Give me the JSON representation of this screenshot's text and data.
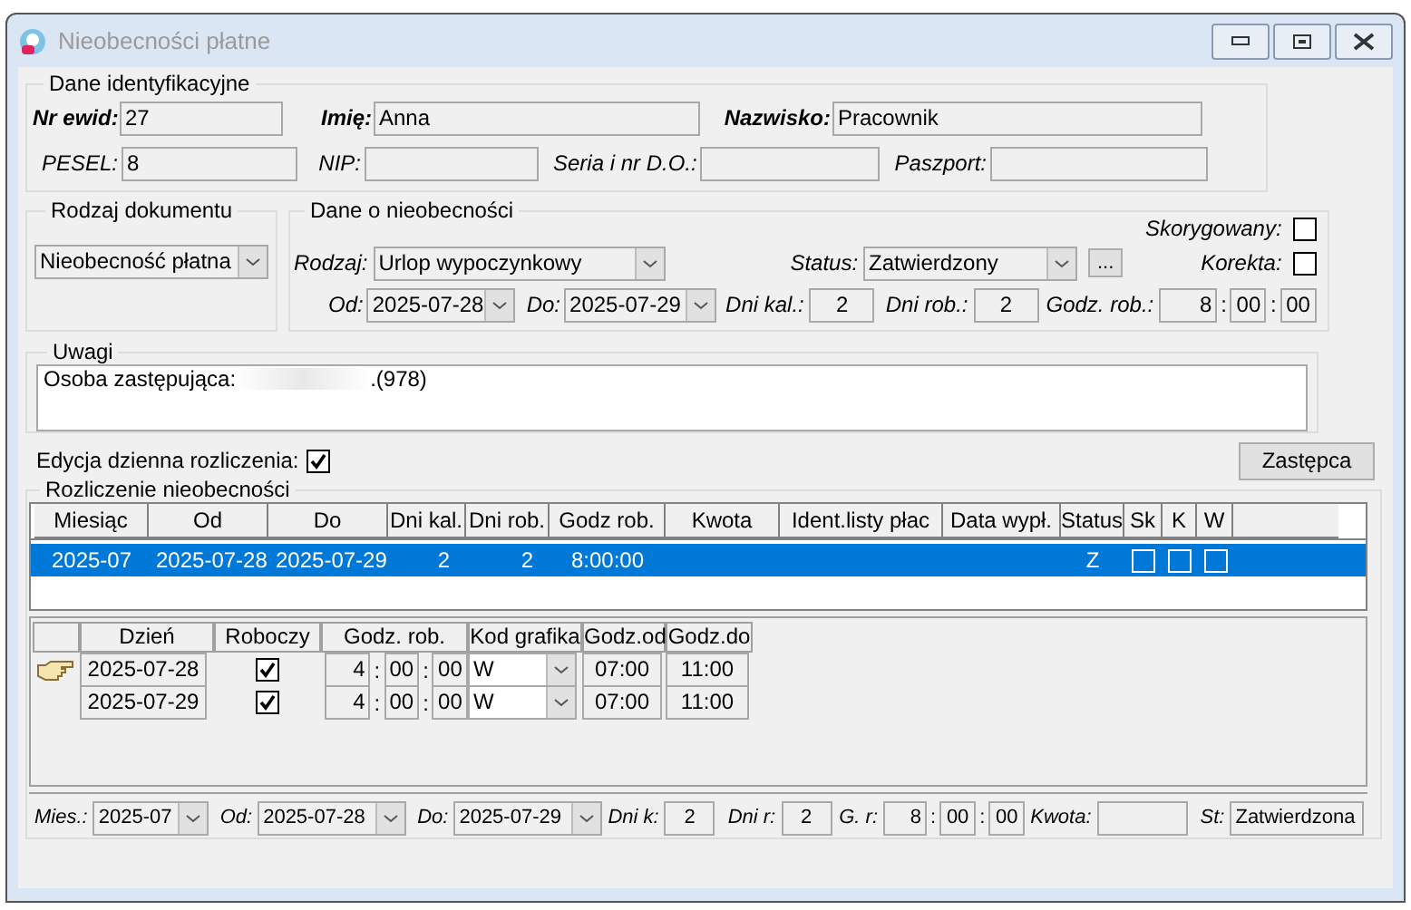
{
  "window": {
    "title": "Nieobecności płatne"
  },
  "identification": {
    "title": "Dane identyfikacyjne",
    "rows": [
      [
        {
          "label": "Nr ewid:",
          "required": true,
          "value": "27"
        },
        {
          "label": "Imię:",
          "required": true,
          "value": "Anna"
        },
        {
          "label": "Nazwisko:",
          "required": true,
          "value": "Pracownik"
        }
      ],
      [
        {
          "label": "PESEL:",
          "required": false,
          "value": "8"
        },
        {
          "label": "NIP:",
          "required": false
        },
        {
          "label": "Seria i nr D.O.:",
          "required": false
        },
        {
          "label": "Paszport:",
          "required": false
        }
      ]
    ]
  },
  "document_type": {
    "title": "Rodzaj dokumentu",
    "value": "Nieobecność płatna"
  },
  "absence": {
    "title": "Dane o nieobecności",
    "corrected": {
      "label": "Skorygowany:",
      "checked": false
    },
    "type": {
      "label": "Rodzaj:",
      "value": "Urlop wypoczynkowy"
    },
    "status": {
      "label": "Status:",
      "value": "Zatwierdzony",
      "more": "..."
    },
    "correction": {
      "label": "Korekta:",
      "checked": false
    },
    "from": {
      "label": "Od:",
      "value": "2025-07-28"
    },
    "to": {
      "label": "Do:",
      "value": "2025-07-29"
    },
    "cal_days": {
      "label": "Dni kal.:",
      "value": "2"
    },
    "work_days": {
      "label": "Dni rob.:",
      "value": "2"
    },
    "hours": {
      "label": "Godz. rob.:",
      "h": "8",
      "sep1": ":",
      "m": "00",
      "sep2": ":",
      "s": "00"
    }
  },
  "notes": {
    "title": "Uwagi",
    "value_start": "Osoba zastępująca:",
    "value_end": ".(978)"
  },
  "daily_edit": {
    "label": "Edycja dzienna rozliczenia:",
    "checked": true
  },
  "substitute_button": "Zastępca",
  "settlement": {
    "title": "Rozliczenie nieobecności",
    "columns": [
      "Miesiąc",
      "Od",
      "Do",
      "Dni kal.",
      "Dni rob.",
      "Godz rob.",
      "Kwota",
      "Ident.listy płac",
      "Data wypł.",
      "Status",
      "Sk",
      "K",
      "W"
    ],
    "rows": [
      {
        "selected": true,
        "month": "2025-07",
        "from": "2025-07-28",
        "to": "2025-07-29",
        "cal_days": "2",
        "work_days": "2",
        "hours": "8:00:00",
        "status": "Z",
        "sk": false,
        "k": false,
        "w": false
      }
    ]
  },
  "days": {
    "columns": [
      "Dzień",
      "Roboczy",
      "Godz. rob.",
      "Kod grafika",
      "Godz.od",
      "Godz.do"
    ],
    "rows": [
      {
        "current": true,
        "day": "2025-07-28",
        "working": true,
        "h": "4",
        "sep1": ":",
        "m": "00",
        "sep2": ":",
        "s": "00",
        "code": "W",
        "from": "07:00",
        "to": "11:00"
      },
      {
        "current": false,
        "day": "2025-07-29",
        "working": true,
        "h": "4",
        "sep1": ":",
        "m": "00",
        "sep2": ":",
        "s": "00",
        "code": "W",
        "from": "07:00",
        "to": "11:00"
      }
    ]
  },
  "footer": {
    "month": {
      "label": "Mies.:",
      "value": "2025-07"
    },
    "from": {
      "label": "Od:",
      "value": "2025-07-28"
    },
    "to": {
      "label": "Do:",
      "value": "2025-07-29"
    },
    "cal_days": {
      "label": "Dni k:",
      "value": "2"
    },
    "work_days": {
      "label": "Dni r:",
      "value": "2"
    },
    "hours": {
      "label": "G. r:",
      "h": "8",
      "sep1": ":",
      "m": "00",
      "sep2": ":",
      "s": "00"
    },
    "amount": {
      "label": "Kwota:"
    },
    "state": {
      "label": "St:",
      "value": "Zatwierdzona"
    }
  }
}
